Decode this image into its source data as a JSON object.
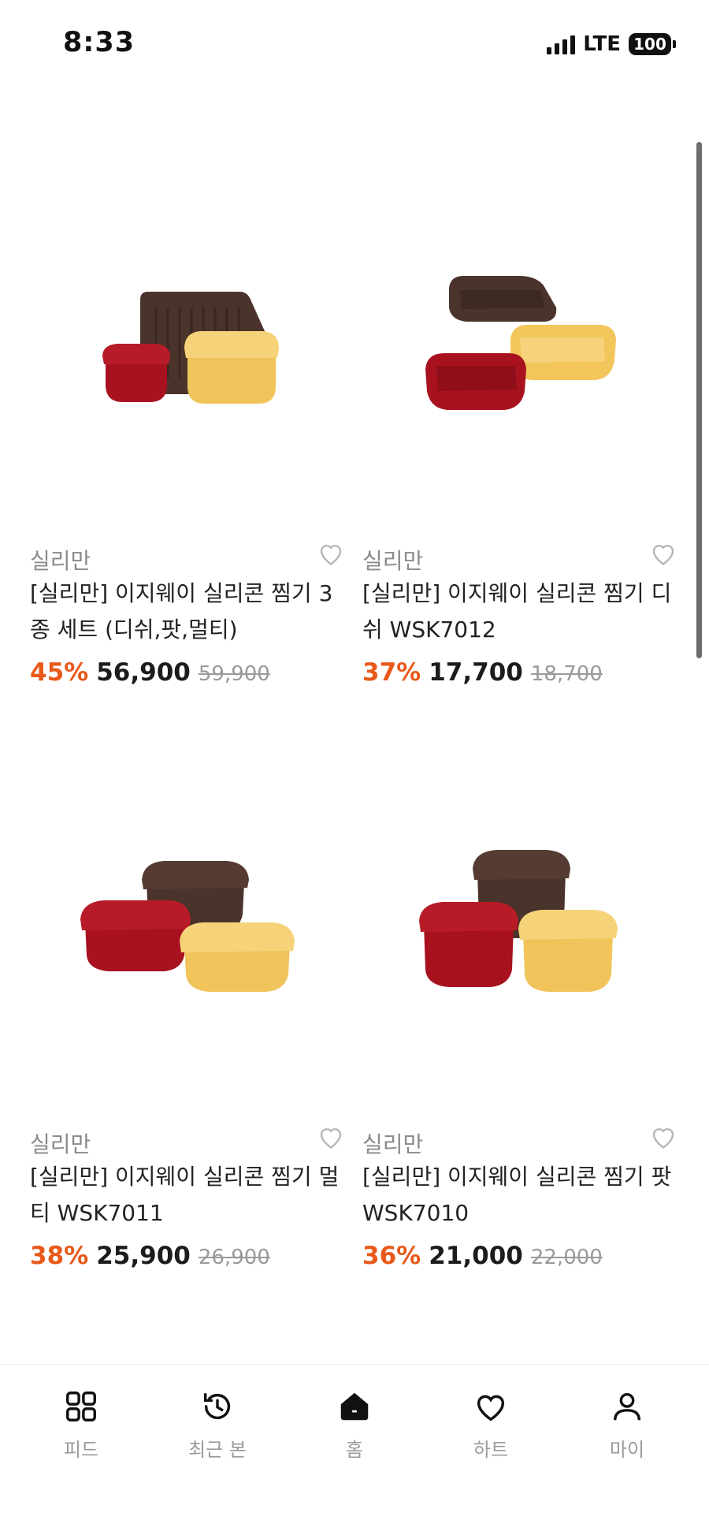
{
  "status": {
    "time": "8:33",
    "network": "LTE",
    "battery": "100"
  },
  "products": [
    {
      "brand": "실리만",
      "title": "[실리만] 이지웨이 실리콘 찜기 3종 세트 (디쉬,팟,멀티)",
      "discount": "45%",
      "price": "56,900",
      "original_price": "59,900",
      "image_desc": "tray-red-yellow-set"
    },
    {
      "brand": "실리만",
      "title": "[실리만] 이지웨이 실리콘 찜기 디쉬 WSK7012",
      "discount": "37%",
      "price": "17,700",
      "original_price": "18,700",
      "image_desc": "dish-set"
    },
    {
      "brand": "실리만",
      "title": "[실리만] 이지웨이 실리콘 찜기 멀티 WSK7011",
      "discount": "38%",
      "price": "25,900",
      "original_price": "26,900",
      "image_desc": "multi-set"
    },
    {
      "brand": "실리만",
      "title": "[실리만] 이지웨이 실리콘 찜기 팟 WSK7010",
      "discount": "36%",
      "price": "21,000",
      "original_price": "22,000",
      "image_desc": "pot-set"
    }
  ],
  "tabs": [
    {
      "label": "피드",
      "icon": "grid-icon"
    },
    {
      "label": "최근 본",
      "icon": "history-icon"
    },
    {
      "label": "홈",
      "icon": "home-icon"
    },
    {
      "label": "하트",
      "icon": "heart-icon"
    },
    {
      "label": "마이",
      "icon": "person-icon"
    }
  ],
  "colors": {
    "discount": "#e8591a",
    "brown": "#4a332b",
    "red": "#a8121f",
    "yellow": "#f2c863"
  }
}
